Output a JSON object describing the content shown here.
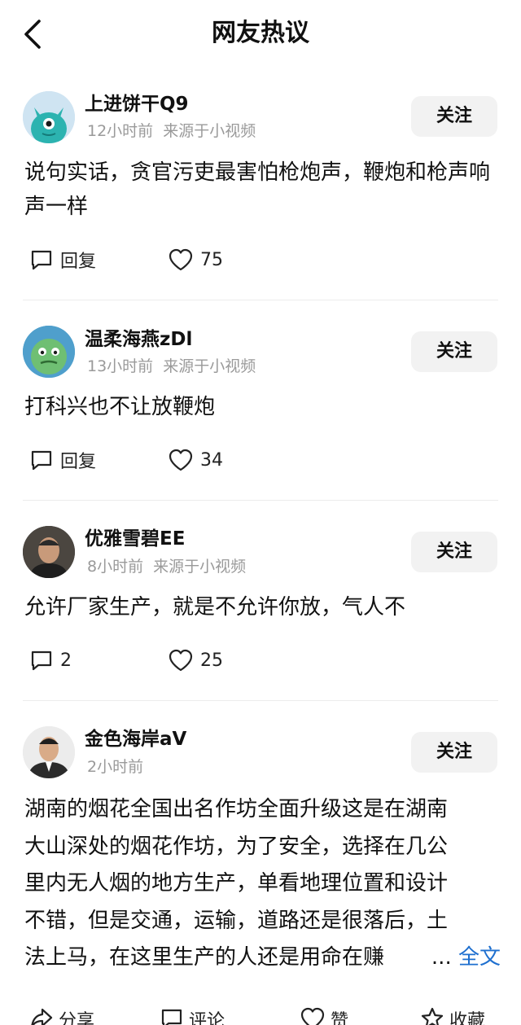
{
  "header": {
    "title": "网友热议"
  },
  "comments": [
    {
      "username": "上进饼干Q9",
      "time": "12小时前",
      "source": "来源于小视频",
      "follow_label": "关注",
      "text": "说句实话，贪官污吏最害怕枪炮声，鞭炮和枪声响声一样",
      "reply_label": "回复",
      "likes": "75"
    },
    {
      "username": "温柔海燕zDl",
      "time": "13小时前",
      "source": "来源于小视频",
      "follow_label": "关注",
      "text": "打科兴也不让放鞭炮",
      "reply_label": "回复",
      "likes": "34"
    },
    {
      "username": "优雅雪碧EE",
      "time": "8小时前",
      "source": "来源于小视频",
      "follow_label": "关注",
      "text": "允许厂家生产，就是不允许你放，气人不",
      "reply_label": "2",
      "likes": "25"
    },
    {
      "username": "金色海岸aV",
      "time": "2小时前",
      "follow_label": "关注",
      "lines": [
        "湖南的烟花全国出名作坊全面升级这是在湖南",
        "大山深处的烟花作坊，为了安全，选择在几公",
        "里内无人烟的地方生产，单看地理位置和设计",
        "不错，但是交通，运输，道路还是很落后，土",
        "法上马，在这里生产的人还是用命在赚"
      ],
      "ellipsis": "...",
      "full_text_label": "全文"
    }
  ],
  "bottom_bar": {
    "share": "分享",
    "comment": "评论",
    "like": "赞",
    "favorite": "收藏"
  }
}
